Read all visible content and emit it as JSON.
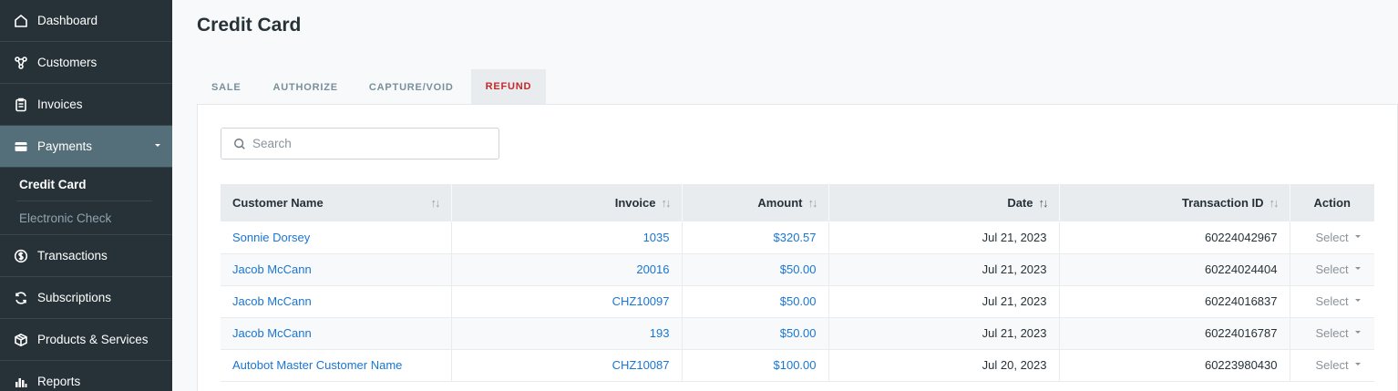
{
  "sidebar": {
    "items": [
      {
        "label": "Dashboard",
        "icon": "home-icon"
      },
      {
        "label": "Customers",
        "icon": "customers-icon"
      },
      {
        "label": "Invoices",
        "icon": "invoice-icon"
      },
      {
        "label": "Payments",
        "icon": "card-icon"
      },
      {
        "label": "Transactions",
        "icon": "dollar-icon"
      },
      {
        "label": "Subscriptions",
        "icon": "refresh-icon"
      },
      {
        "label": "Products & Services",
        "icon": "box-icon"
      },
      {
        "label": "Reports",
        "icon": "chart-icon"
      }
    ],
    "sub_items": [
      {
        "label": "Credit Card"
      },
      {
        "label": "Electronic Check"
      }
    ]
  },
  "page": {
    "title": "Credit Card"
  },
  "tabs": [
    {
      "label": "SALE"
    },
    {
      "label": "AUTHORIZE"
    },
    {
      "label": "CAPTURE/VOID"
    },
    {
      "label": "REFUND"
    }
  ],
  "search": {
    "placeholder": "Search"
  },
  "table": {
    "headers": {
      "customer": "Customer Name",
      "invoice": "Invoice",
      "amount": "Amount",
      "date": "Date",
      "transaction": "Transaction ID",
      "action": "Action"
    },
    "rows": [
      {
        "customer": "Sonnie Dorsey",
        "invoice": "1035",
        "amount": "$320.57",
        "date": "Jul 21, 2023",
        "transaction": "60224042967",
        "action": "Select"
      },
      {
        "customer": "Jacob McCann",
        "invoice": "20016",
        "amount": "$50.00",
        "date": "Jul 21, 2023",
        "transaction": "60224024404",
        "action": "Select"
      },
      {
        "customer": "Jacob McCann",
        "invoice": "CHZ10097",
        "amount": "$50.00",
        "date": "Jul 21, 2023",
        "transaction": "60224016837",
        "action": "Select"
      },
      {
        "customer": "Jacob McCann",
        "invoice": "193",
        "amount": "$50.00",
        "date": "Jul 21, 2023",
        "transaction": "60224016787",
        "action": "Select"
      },
      {
        "customer": "Autobot Master Customer Name",
        "invoice": "CHZ10087",
        "amount": "$100.00",
        "date": "Jul 20, 2023",
        "transaction": "60223980430",
        "action": "Select"
      }
    ]
  },
  "colors": {
    "sidebar_bg": "#263238",
    "sidebar_active": "#546e7a",
    "link": "#1976d2",
    "active_tab": "#c62828"
  }
}
